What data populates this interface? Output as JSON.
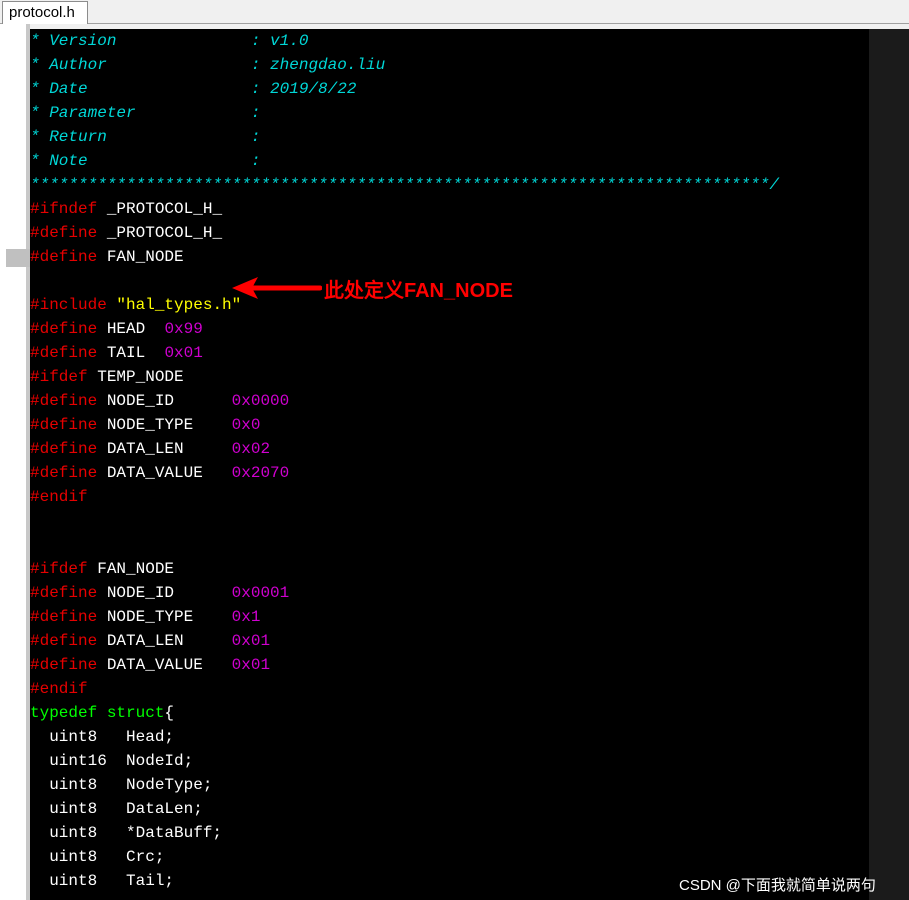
{
  "tab": {
    "title": "protocol.h"
  },
  "lines": [
    [
      {
        "c": "comment",
        "t": "* Version              : v1.0"
      }
    ],
    [
      {
        "c": "comment",
        "t": "* Author               : zhengdao.liu"
      }
    ],
    [
      {
        "c": "comment",
        "t": "* Date                 : 2019/8/22"
      }
    ],
    [
      {
        "c": "comment",
        "t": "* Parameter            :"
      }
    ],
    [
      {
        "c": "comment",
        "t": "* Return               :"
      }
    ],
    [
      {
        "c": "comment",
        "t": "* Note                 :"
      }
    ],
    [
      {
        "c": "comment",
        "t": "*****************************************************************************/"
      }
    ],
    [
      {
        "c": "pp",
        "t": "#ifndef"
      },
      {
        "c": "id",
        "t": " _PROTOCOL_H_"
      }
    ],
    [
      {
        "c": "pp",
        "t": "#define"
      },
      {
        "c": "id",
        "t": " _PROTOCOL_H_"
      }
    ],
    [
      {
        "c": "pp",
        "t": "#define"
      },
      {
        "c": "id",
        "t": " FAN_NODE"
      }
    ],
    [],
    [
      {
        "c": "pp",
        "t": "#include"
      },
      {
        "c": "id",
        "t": " "
      },
      {
        "c": "str",
        "t": "\"hal_types.h\""
      }
    ],
    [
      {
        "c": "pp",
        "t": "#define"
      },
      {
        "c": "id",
        "t": " HEAD  "
      },
      {
        "c": "num",
        "t": "0x99"
      }
    ],
    [
      {
        "c": "pp",
        "t": "#define"
      },
      {
        "c": "id",
        "t": " TAIL  "
      },
      {
        "c": "num",
        "t": "0x01"
      }
    ],
    [
      {
        "c": "pp",
        "t": "#ifdef"
      },
      {
        "c": "id",
        "t": " TEMP_NODE"
      }
    ],
    [
      {
        "c": "pp",
        "t": "#define"
      },
      {
        "c": "id",
        "t": " NODE_ID      "
      },
      {
        "c": "num",
        "t": "0x0000"
      }
    ],
    [
      {
        "c": "pp",
        "t": "#define"
      },
      {
        "c": "id",
        "t": " NODE_TYPE    "
      },
      {
        "c": "num",
        "t": "0x0"
      }
    ],
    [
      {
        "c": "pp",
        "t": "#define"
      },
      {
        "c": "id",
        "t": " DATA_LEN     "
      },
      {
        "c": "num",
        "t": "0x02"
      }
    ],
    [
      {
        "c": "pp",
        "t": "#define"
      },
      {
        "c": "id",
        "t": " DATA_VALUE   "
      },
      {
        "c": "num",
        "t": "0x2070"
      }
    ],
    [
      {
        "c": "pp",
        "t": "#endif"
      }
    ],
    [],
    [],
    [
      {
        "c": "pp",
        "t": "#ifdef"
      },
      {
        "c": "id",
        "t": " FAN_NODE"
      }
    ],
    [
      {
        "c": "pp",
        "t": "#define"
      },
      {
        "c": "id",
        "t": " NODE_ID      "
      },
      {
        "c": "num",
        "t": "0x0001"
      }
    ],
    [
      {
        "c": "pp",
        "t": "#define"
      },
      {
        "c": "id",
        "t": " NODE_TYPE    "
      },
      {
        "c": "num",
        "t": "0x1"
      }
    ],
    [
      {
        "c": "pp",
        "t": "#define"
      },
      {
        "c": "id",
        "t": " DATA_LEN     "
      },
      {
        "c": "num",
        "t": "0x01"
      }
    ],
    [
      {
        "c": "pp",
        "t": "#define"
      },
      {
        "c": "id",
        "t": " DATA_VALUE   "
      },
      {
        "c": "num",
        "t": "0x01"
      }
    ],
    [
      {
        "c": "pp",
        "t": "#endif"
      }
    ],
    [
      {
        "c": "kw",
        "t": "typedef struct"
      },
      {
        "c": "id",
        "t": "{"
      }
    ],
    [
      {
        "c": "id",
        "t": "  uint8   Head;"
      }
    ],
    [
      {
        "c": "id",
        "t": "  uint16  NodeId;"
      }
    ],
    [
      {
        "c": "id",
        "t": "  uint8   NodeType;"
      }
    ],
    [
      {
        "c": "id",
        "t": "  uint8   DataLen;"
      }
    ],
    [
      {
        "c": "id",
        "t": "  uint8   *DataBuff;"
      }
    ],
    [
      {
        "c": "id",
        "t": "  uint8   Crc;"
      }
    ],
    [
      {
        "c": "id",
        "t": "  uint8   Tail;"
      }
    ]
  ],
  "annotation": {
    "text": "此处定义FAN_NODE",
    "color": "#ff0000"
  },
  "watermark": {
    "text": "CSDN @下面我就简单说两句"
  }
}
